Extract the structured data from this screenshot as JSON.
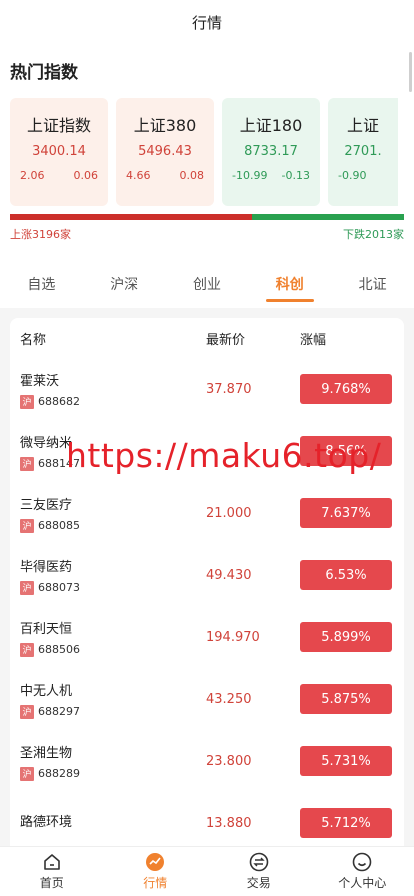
{
  "header": {
    "title": "行情"
  },
  "hot": {
    "title": "热门指数",
    "cards": [
      {
        "name": "上证指数",
        "price": "3400.14",
        "change": "2.06",
        "pct": "0.06",
        "trend": "up"
      },
      {
        "name": "上证380",
        "price": "5496.43",
        "change": "4.66",
        "pct": "0.08",
        "trend": "up"
      },
      {
        "name": "上证180",
        "price": "8733.17",
        "change": "-10.99",
        "pct": "-0.13",
        "trend": "down"
      },
      {
        "name": "上证",
        "price": "2701.",
        "change": "-0.90",
        "pct": "",
        "trend": "down"
      }
    ],
    "up_label": "上涨3196家",
    "down_label": "下跌2013家",
    "up_ratio": 0.614
  },
  "tabs": [
    {
      "label": "自选",
      "active": false
    },
    {
      "label": "沪深",
      "active": false
    },
    {
      "label": "创业",
      "active": false
    },
    {
      "label": "科创",
      "active": true
    },
    {
      "label": "北证",
      "active": false
    }
  ],
  "table": {
    "headers": {
      "name": "名称",
      "price": "最新价",
      "pct": "涨幅"
    },
    "rows": [
      {
        "name": "霍莱沃",
        "market": "沪",
        "code": "688682",
        "price": "37.870",
        "pct": "9.768%"
      },
      {
        "name": "微导纳米",
        "market": "沪",
        "code": "688147",
        "price": "",
        "pct": "8.56%"
      },
      {
        "name": "三友医疗",
        "market": "沪",
        "code": "688085",
        "price": "21.000",
        "pct": "7.637%"
      },
      {
        "name": "毕得医药",
        "market": "沪",
        "code": "688073",
        "price": "49.430",
        "pct": "6.53%"
      },
      {
        "name": "百利天恒",
        "market": "沪",
        "code": "688506",
        "price": "194.970",
        "pct": "5.899%"
      },
      {
        "name": "中无人机",
        "market": "沪",
        "code": "688297",
        "price": "43.250",
        "pct": "5.875%"
      },
      {
        "name": "圣湘生物",
        "market": "沪",
        "code": "688289",
        "price": "23.800",
        "pct": "5.731%"
      },
      {
        "name": "路德环境",
        "market": "",
        "code": "",
        "price": "13.880",
        "pct": "5.712%"
      }
    ]
  },
  "watermark": "https://maku6.top/",
  "nav": [
    {
      "label": "首页",
      "icon": "home-icon",
      "active": false
    },
    {
      "label": "行情",
      "icon": "market-icon",
      "active": true
    },
    {
      "label": "交易",
      "icon": "trade-icon",
      "active": false
    },
    {
      "label": "个人中心",
      "icon": "profile-icon",
      "active": false
    }
  ],
  "colors": {
    "accent": "#f0812e",
    "up": "#d0433a",
    "down": "#2f9a57",
    "pct_bg": "#e5484d"
  }
}
